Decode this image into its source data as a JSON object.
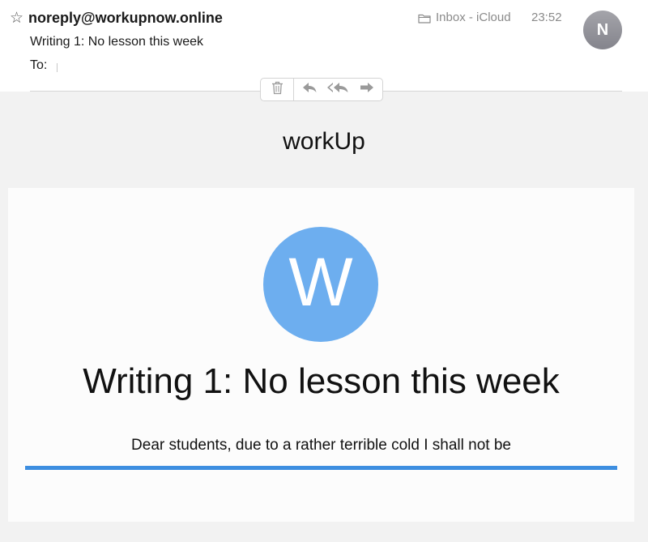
{
  "message": {
    "star_icon": "star-outline-icon",
    "sender": "noreply@workupnow.online",
    "subject": "Writing 1: No lesson this week",
    "to_label": "To:",
    "mailbox": "Inbox - iCloud",
    "time": "23:52",
    "avatar_initial": "N"
  },
  "toolbar": {
    "icons": [
      "trash-icon",
      "reply-icon",
      "reply-all-icon",
      "forward-icon"
    ]
  },
  "email_body": {
    "brand": "workUp",
    "logo_letter": "W",
    "headline": "Writing 1: No lesson this week",
    "text": "Dear students, due to a rather terrible cold I shall not be"
  },
  "colors": {
    "logo_circle": "#6daeef",
    "accent_bar": "#3d8ee0",
    "avatar": "#95959c",
    "canvas_bg": "#f2f2f2"
  }
}
